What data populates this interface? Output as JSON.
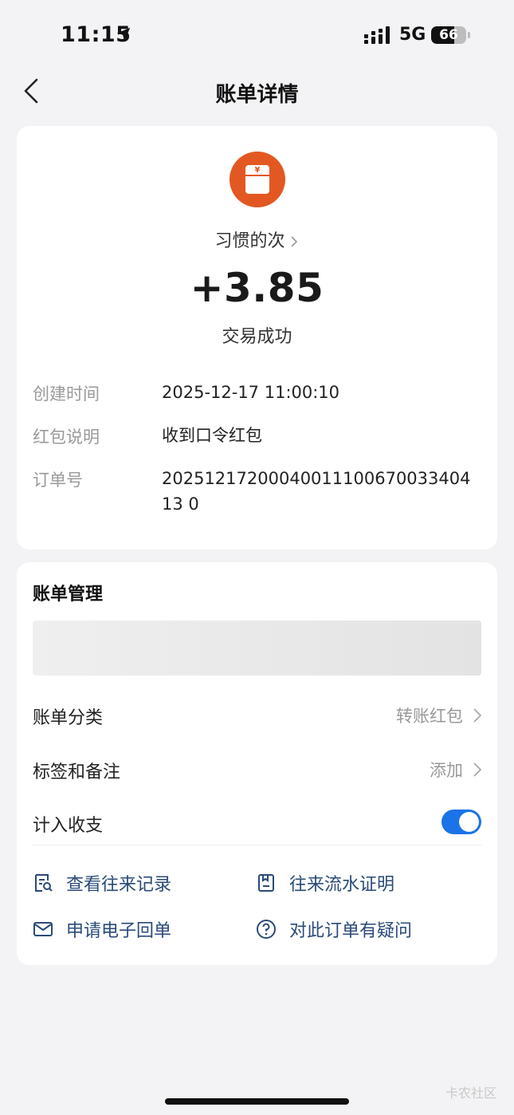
{
  "status_bar": {
    "time": "11:15",
    "network": "5G",
    "battery_level": 66,
    "battery_text": "66",
    "icons": [
      "location-arrow-icon",
      "signal-icon"
    ]
  },
  "nav": {
    "title": "账单详情",
    "back_icon": "chevron-left-icon"
  },
  "transaction": {
    "icon": "red-envelope-icon",
    "icon_color": "#e35822",
    "payer_name": "习惯的次",
    "amount": "+3.85",
    "status": "交易成功",
    "details": [
      {
        "label": "创建时间",
        "value": "2025-12-17 11:00:10"
      },
      {
        "label": "红包说明",
        "value": "收到口令红包"
      },
      {
        "label": "订单号",
        "value": "2025121720004001110067003340413 0"
      }
    ]
  },
  "manage": {
    "title": "账单管理",
    "category": {
      "label": "账单分类",
      "value": "转账红包"
    },
    "tags": {
      "label": "标签和备注",
      "value": "添加"
    },
    "count_in": {
      "label": "计入收支",
      "enabled": true
    },
    "toggle_color": "#1a73e8",
    "links": [
      {
        "label": "查看往来记录",
        "icon": "records-search-icon"
      },
      {
        "label": "往来流水证明",
        "icon": "statement-doc-icon"
      },
      {
        "label": "申请电子回单",
        "icon": "mail-icon"
      },
      {
        "label": "对此订单有疑问",
        "icon": "question-circle-icon"
      }
    ],
    "link_color": "#2a4a78"
  },
  "watermark": "卡农社区"
}
